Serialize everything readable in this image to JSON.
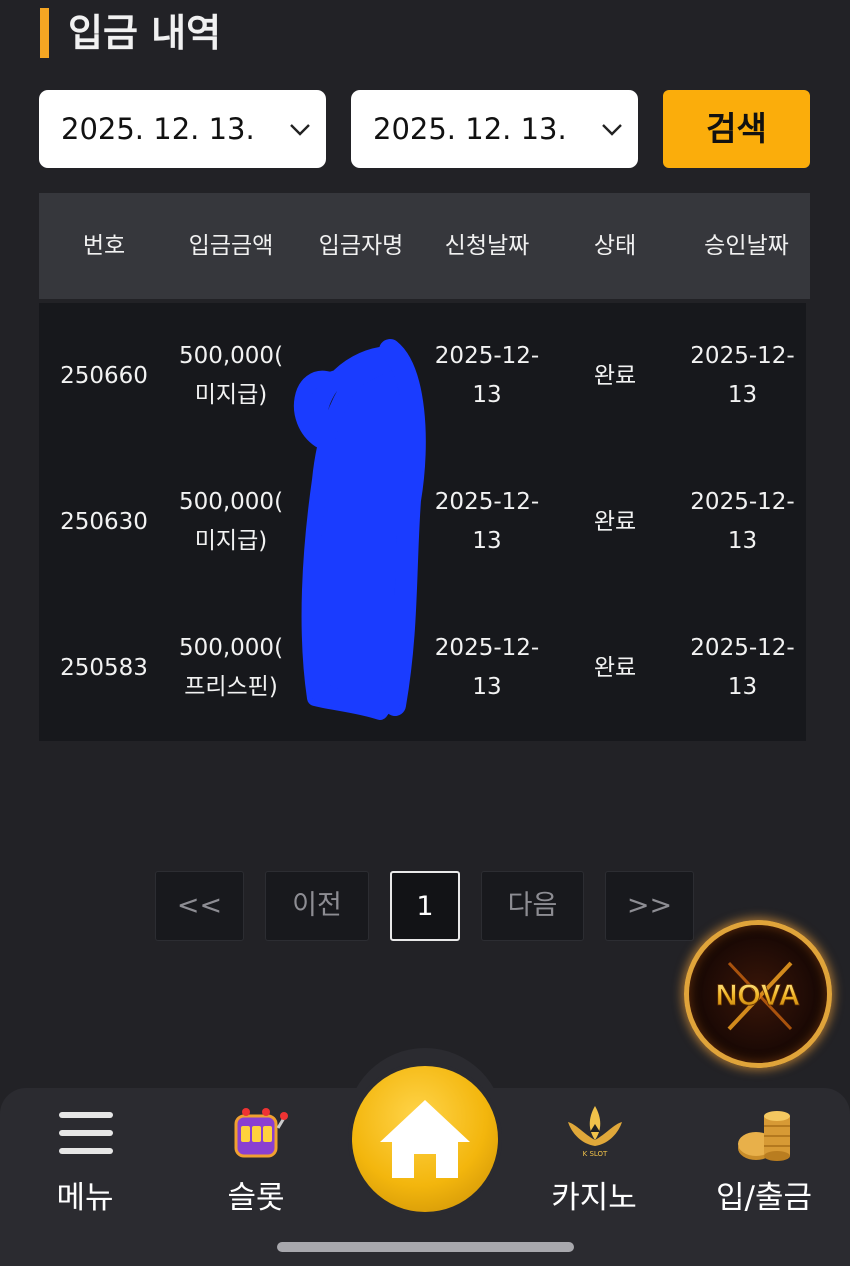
{
  "header": {
    "title": "입금 내역"
  },
  "filters": {
    "date_from": "2025. 12. 13.",
    "date_to": "2025. 12. 13.",
    "search_label": "검색"
  },
  "table": {
    "headers": [
      "번호",
      "입금금액",
      "입금자명",
      "신청날짜",
      "상태",
      "승인날짜"
    ],
    "rows": [
      {
        "no": "250660",
        "amount": "500,000(",
        "amount_note": "미지급)",
        "depositor": "",
        "request_date": "2025-12-",
        "request_date_2": "13",
        "status": "완료",
        "approve_date": "2025-12-",
        "approve_date_2": "13"
      },
      {
        "no": "250630",
        "amount": "500,000(",
        "amount_note": "미지급)",
        "depositor": "",
        "request_date": "2025-12-",
        "request_date_2": "13",
        "status": "완료",
        "approve_date": "2025-12-",
        "approve_date_2": "13"
      },
      {
        "no": "250583",
        "amount": "500,000(",
        "amount_note": "프리스핀)",
        "depositor": "",
        "request_date": "2025-12-",
        "request_date_2": "13",
        "status": "완료",
        "approve_date": "2025-12-",
        "approve_date_2": "13"
      }
    ]
  },
  "pagination": {
    "first": "<<",
    "prev": "이전",
    "current": "1",
    "next": "다음",
    "last": ">>"
  },
  "logo": {
    "text": "NOVA"
  },
  "bottom_nav": {
    "menu": "메뉴",
    "slot": "슬롯",
    "casino": "카지노",
    "casino_badge": "K SLOT",
    "bank": "입/출금"
  },
  "colors": {
    "accent": "#fbad0b",
    "background": "#222226",
    "table_header": "#36373c",
    "table_body": "#17181c",
    "redaction": "#1a3cff"
  }
}
